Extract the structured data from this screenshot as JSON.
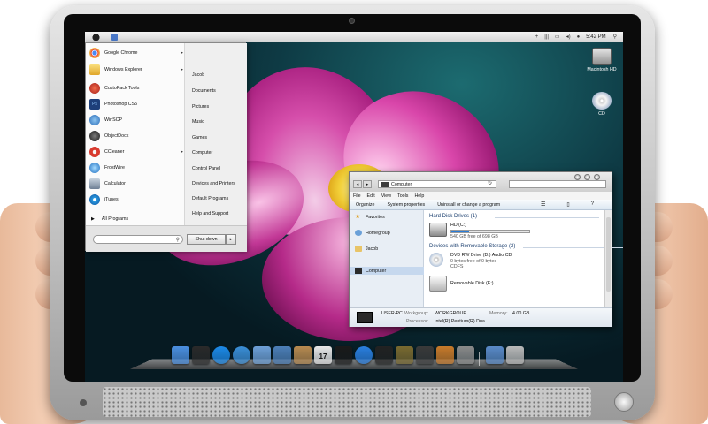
{
  "menubar": {
    "time": "5:42 PM",
    "icons": [
      "plus-icon",
      "bars-icon",
      "battery-icon",
      "volume-icon",
      "user-icon"
    ]
  },
  "start_menu": {
    "left_items": [
      {
        "label": "Google Chrome",
        "icon": "chrome-icon",
        "color": "#e94235",
        "submenu": true
      },
      {
        "label": "Windows Explorer",
        "icon": "explorer-icon",
        "color": "#f2c44c",
        "submenu": true
      },
      {
        "label": "CustoPack Tools",
        "icon": "custopack-icon",
        "color": "#c23c2a",
        "submenu": false
      },
      {
        "label": "Photoshop CS5",
        "icon": "photoshop-icon",
        "color": "#1e3f7a",
        "submenu": false
      },
      {
        "label": "WinSCP",
        "icon": "winscp-icon",
        "color": "#3a7ec8",
        "submenu": false
      },
      {
        "label": "ObjectDock",
        "icon": "objectdock-icon",
        "color": "#3a3a3a",
        "submenu": false
      },
      {
        "label": "CCleaner",
        "icon": "ccleaner-icon",
        "color": "#c8352a",
        "submenu": true
      },
      {
        "label": "FrostWire",
        "icon": "frostwire-icon",
        "color": "#2f86d4",
        "submenu": false
      },
      {
        "label": "Calculator",
        "icon": "calculator-icon",
        "color": "#6e7f95",
        "submenu": false
      },
      {
        "label": "iTunes",
        "icon": "itunes-icon",
        "color": "#2c9be0",
        "submenu": false
      }
    ],
    "all_programs": "All Programs",
    "right_items": [
      "Jacob",
      "Documents",
      "Pictures",
      "Music",
      "Games",
      "Computer",
      "Control Panel",
      "Devices and Printers",
      "Default Programs",
      "Help and Support"
    ],
    "shutdown_label": "Shut down"
  },
  "desktop_icons": [
    {
      "label": "Macintosh HD",
      "icon": "hard-drive-icon"
    },
    {
      "label": "CD",
      "icon": "cd-icon"
    }
  ],
  "explorer": {
    "address": "Computer",
    "menu": [
      "File",
      "Edit",
      "View",
      "Tools",
      "Help"
    ],
    "toolbar": [
      "Organize",
      "System properties",
      "Uninstall or change a program"
    ],
    "nav": [
      "Favorites",
      "Homegroup",
      "Jacob",
      "Computer"
    ],
    "group_hdd": "Hard Disk Drives (1)",
    "drive_hd_name": "HD (C:)",
    "drive_hd_free": "540 GB free of 698 GB",
    "drive_hd_used_fraction": 0.23,
    "group_removable": "Devices with Removable Storage (2)",
    "drive_dvd_name": "DVD RW Drive (D:) Audio CD",
    "drive_dvd_free": "0 bytes free of 0 bytes",
    "drive_dvd_fs": "CDFS",
    "drive_removable_name": "Removable Disk (E:)",
    "status": {
      "pc_name": "USER-PC",
      "workgroup_label": "Workgroup:",
      "workgroup": "WORKGROUP",
      "memory_label": "Memory:",
      "memory": "4.00 GB",
      "processor_label": "Processor:",
      "processor": "Intel(R) Pentium(R) Dua..."
    }
  },
  "dock": {
    "apps": [
      {
        "name": "finder-icon",
        "color": "#4b8fe0"
      },
      {
        "name": "dashboard-icon",
        "color": "#2a2a2a"
      },
      {
        "name": "app-store-icon",
        "color": "#1d8ae8"
      },
      {
        "name": "safari-icon",
        "color": "#3b8fd8"
      },
      {
        "name": "mail-icon",
        "color": "#6ea0d8"
      },
      {
        "name": "facetime-icon",
        "color": "#4d7fb8"
      },
      {
        "name": "address-book-icon",
        "color": "#b88a50"
      },
      {
        "name": "ical-icon",
        "color": "#e8e8e8"
      },
      {
        "name": "photo-booth-icon",
        "color": "#1a1a1a"
      },
      {
        "name": "itunes-icon",
        "color": "#2a7fe0"
      },
      {
        "name": "dvd-player-icon",
        "color": "#222222"
      },
      {
        "name": "iphoto-icon",
        "color": "#7a6a30"
      },
      {
        "name": "imovie-icon",
        "color": "#3a3a3a"
      },
      {
        "name": "garageband-icon",
        "color": "#c87a2a"
      },
      {
        "name": "system-preferences-icon",
        "color": "#8a8a8a"
      },
      {
        "name": "applications-folder-icon",
        "color": "#5a8ac8"
      },
      {
        "name": "trash-icon",
        "color": "#b9b9b9"
      }
    ],
    "ical_date": "17"
  }
}
